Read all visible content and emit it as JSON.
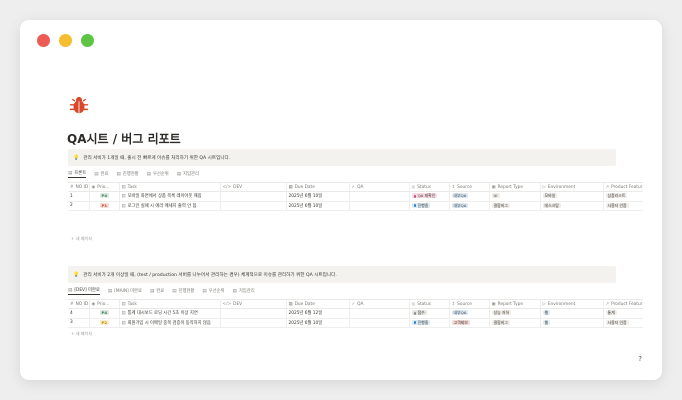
{
  "page": {
    "icon": "bug-icon",
    "title": "QA시트 / 버그 리포트",
    "accent": "#d9482b"
  },
  "sections": [
    {
      "callout": "관리 서비가 1개일 때, 출시 전 빠르게 이슈를 처리하기 위한 QA 시트입니다.",
      "tabs": [
        "프론트",
        "완료",
        "진행현황",
        "우선순위",
        "지입관리"
      ],
      "columns": [
        "NO ID",
        "Prio...",
        "Task",
        "DEV",
        "Due Date",
        "QA",
        "Status",
        "Source",
        "Report Type",
        "Environment",
        "Product Featur"
      ],
      "rows": [
        {
          "no": "1",
          "priority": "P4",
          "task": "모바일 화면에서 상품 목록 레이아웃 깨짐",
          "dev": "",
          "due": "2025년 6월 10일",
          "qa": "",
          "status": "QA 재확인",
          "source": "내부QA",
          "report": "UI",
          "env": "모바일",
          "feature": "상품리스트"
        },
        {
          "no": "2",
          "priority": "P1",
          "task": "로그인 실패 시 에러 메세지 출력 안 됨",
          "dev": "",
          "due": "2025년 6월 10일",
          "qa": "",
          "status": "진행중",
          "source": "내부QA",
          "report": "결함버그",
          "env": "데스크탑",
          "feature": "사용자 인증"
        }
      ],
      "add_row": "새 페이지"
    },
    {
      "callout": "관리 서비가 2개 이상일 때, (test / production 서버를 나누어서 관리하는 경우) 체계적으로 이슈를 관리하기 위한 QA 시트입니다.",
      "tabs": [
        "[DEV] 미완료",
        "[MAIN] 미완료",
        "완료",
        "진행현황",
        "우선순위",
        "지입관리"
      ],
      "columns": [
        "NO ID",
        "Prio...",
        "Task",
        "DEV",
        "Due Date",
        "QA",
        "Status",
        "Source",
        "Report Type",
        "Environment",
        "Product Featur"
      ],
      "rows": [
        {
          "no": "4",
          "priority": "P4",
          "task": "통계 대시보드 로딩 시간 5초 이상 지연",
          "dev": "",
          "due": "2025년 6월 12일",
          "qa": "",
          "status": "접수",
          "source": "내부QA",
          "report": "성능 저하",
          "env": "웹",
          "feature": "통계"
        },
        {
          "no": "3",
          "priority": "P2",
          "task": "회원가입 시 이메일 중복 검증이 동작하지 않음",
          "dev": "",
          "due": "2025년 6월 10일",
          "qa": "",
          "status": "진행중",
          "source": "고객제보",
          "report": "결함버그",
          "env": "웹",
          "feature": "사용자 인증"
        }
      ],
      "add_row": "새 페이지"
    }
  ],
  "colors": {
    "P4": "#dbe9e1",
    "P1": "#f6dcd6",
    "P2": "#fbedc5",
    "status_qa": "#f9dbe4",
    "status_progress": "#dcebf7",
    "status_received": "#e8e6e2",
    "source_internal": "#dcebf7",
    "source_customer": "#f6dcd6"
  }
}
